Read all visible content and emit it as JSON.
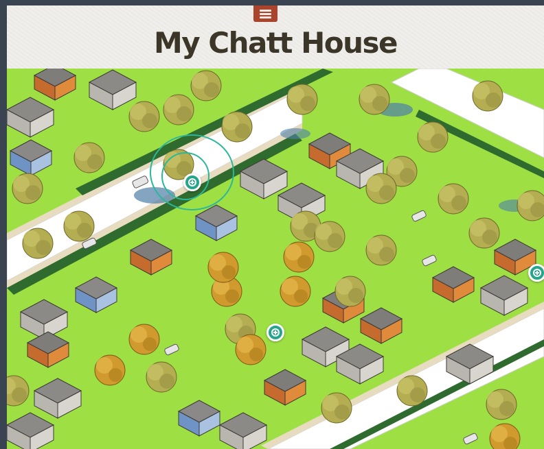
{
  "header": {
    "title": "My Chatt House",
    "menu_icon": "hamburger-menu-icon",
    "menu_color": "#a8452c"
  },
  "map": {
    "colors": {
      "lawn": "#9ee044",
      "road": "#ffffff",
      "sidewalk": "#e8dcc0",
      "tree": "#b7b255",
      "hedge": "#2f6b2e",
      "marker": "#26a58a"
    },
    "markers": [
      {
        "name": "map-marker-1",
        "icon": "plus-circle-icon",
        "selected": true
      },
      {
        "name": "map-marker-2",
        "icon": "plus-circle-icon",
        "selected": false
      },
      {
        "name": "map-marker-3",
        "icon": "plus-circle-icon",
        "selected": false
      }
    ]
  }
}
